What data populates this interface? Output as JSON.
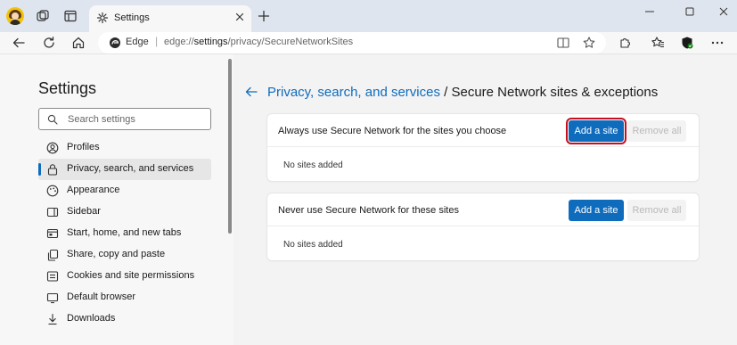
{
  "browser": {
    "tab_title": "Settings",
    "site_name": "Edge",
    "url_host": "edge://",
    "url_bold": "settings",
    "url_path": "/privacy/SecureNetworkSites"
  },
  "sidebar": {
    "title": "Settings",
    "search_placeholder": "Search settings",
    "items": [
      {
        "label": "Profiles",
        "icon": "profile-icon"
      },
      {
        "label": "Privacy, search, and services",
        "icon": "lock-icon",
        "active": true
      },
      {
        "label": "Appearance",
        "icon": "appearance-icon"
      },
      {
        "label": "Sidebar",
        "icon": "sidebar-icon"
      },
      {
        "label": "Start, home, and new tabs",
        "icon": "home-tabs-icon"
      },
      {
        "label": "Share, copy and paste",
        "icon": "share-icon"
      },
      {
        "label": "Cookies and site permissions",
        "icon": "cookies-icon"
      },
      {
        "label": "Default browser",
        "icon": "default-browser-icon"
      },
      {
        "label": "Downloads",
        "icon": "download-icon"
      }
    ]
  },
  "main": {
    "breadcrumb_link": "Privacy, search, and services",
    "breadcrumb_rest": " / Secure Network sites & exceptions",
    "sections": [
      {
        "label": "Always use Secure Network for the sites you choose",
        "add_label": "Add a site",
        "remove_label": "Remove all",
        "empty_text": "No sites added",
        "highlighted": true
      },
      {
        "label": "Never use Secure Network for these sites",
        "add_label": "Add a site",
        "remove_label": "Remove all",
        "empty_text": "No sites added",
        "highlighted": false
      }
    ]
  },
  "colors": {
    "accent": "#0f6cbd",
    "highlight": "#c50f1f"
  }
}
